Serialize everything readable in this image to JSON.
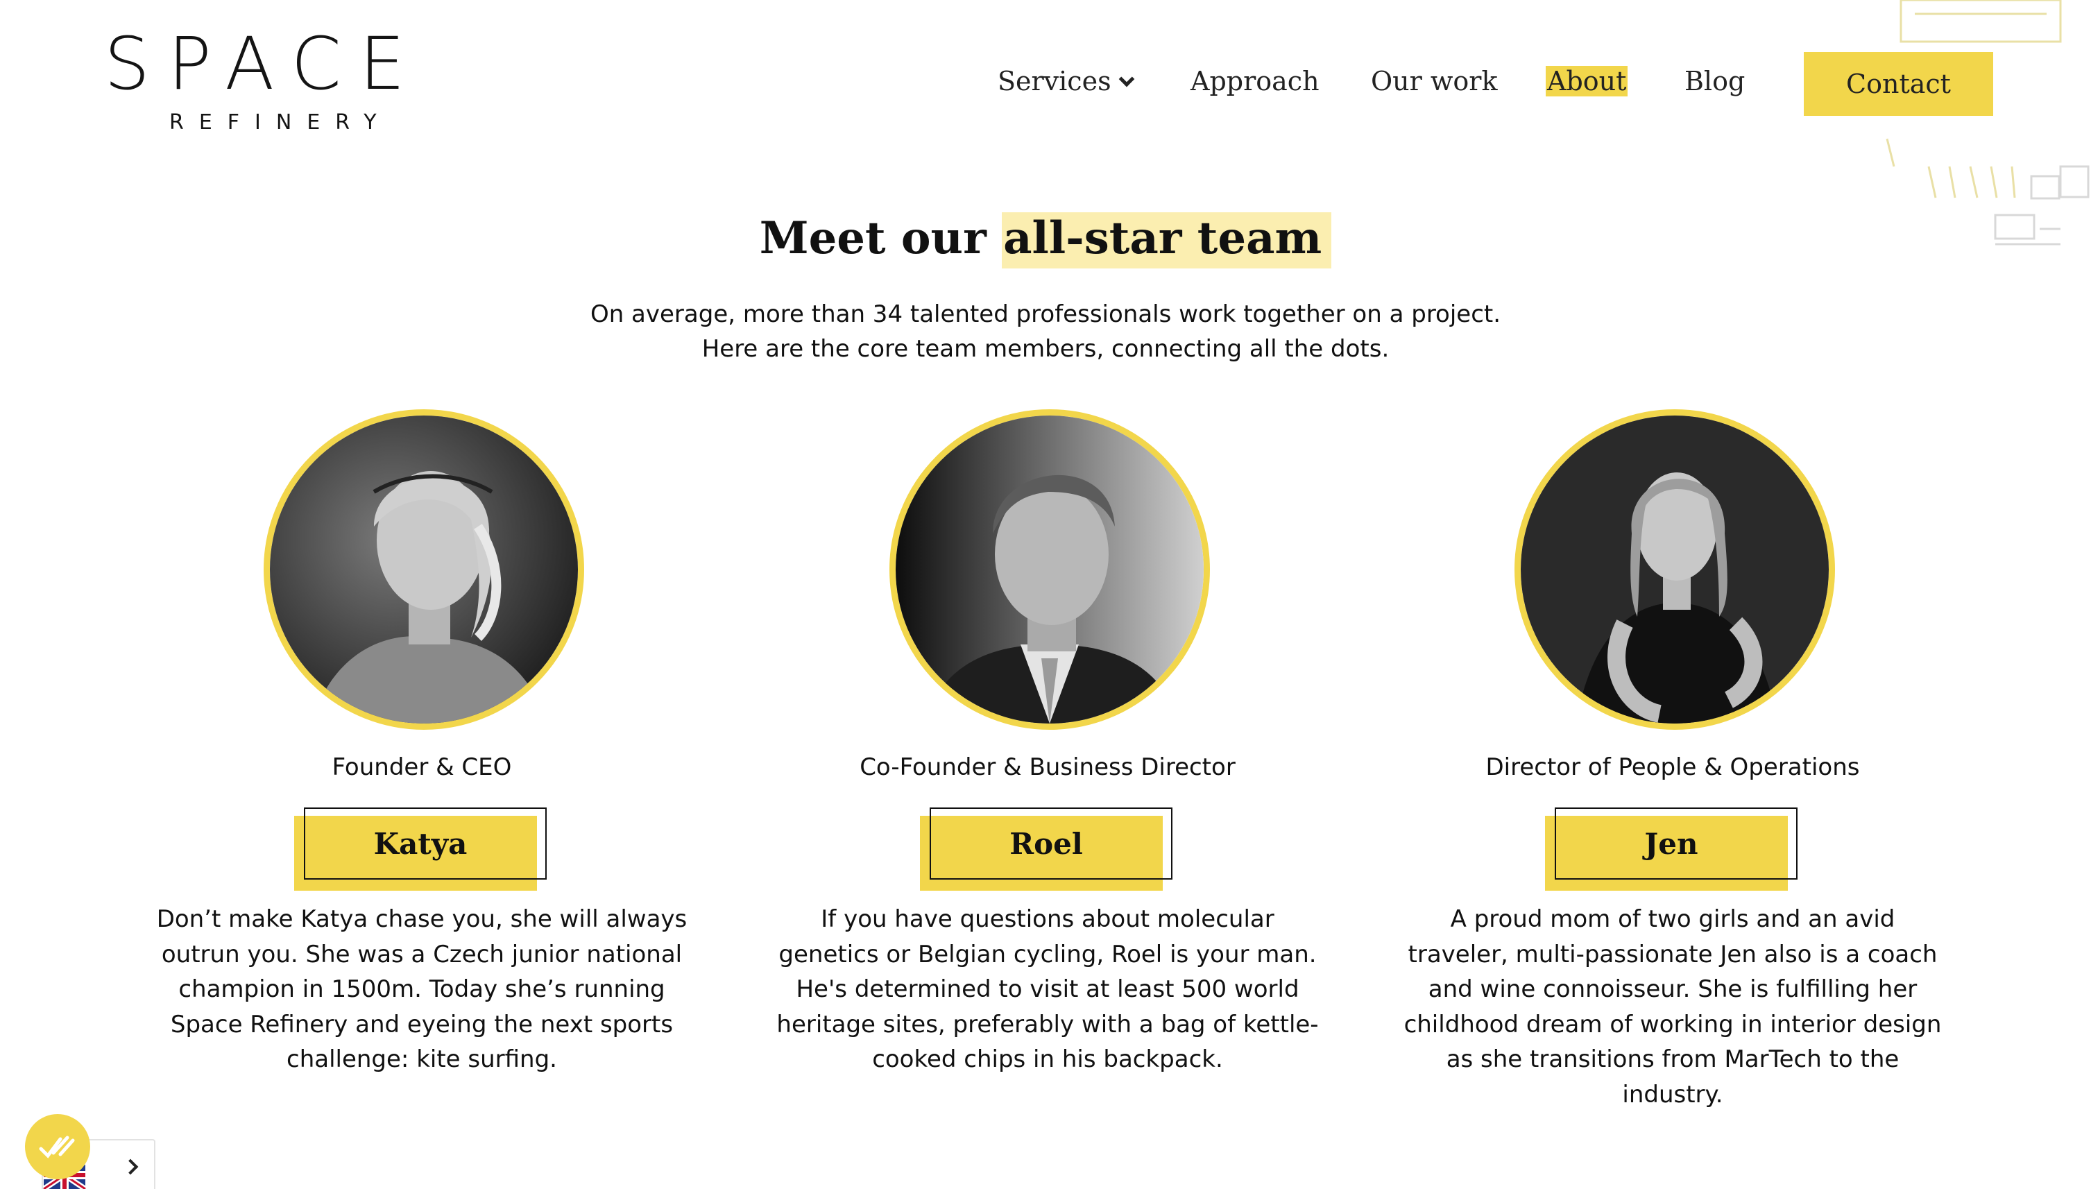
{
  "brand": {
    "logo_main": "SPACE",
    "logo_sub": "REFINERY",
    "accent_color": "#f2d64b"
  },
  "nav": {
    "items": [
      {
        "label": "Services",
        "has_dropdown": true,
        "icon": "chevron-down-icon"
      },
      {
        "label": "Approach"
      },
      {
        "label": "Our work"
      },
      {
        "label": "About",
        "active": true
      },
      {
        "label": "Blog"
      }
    ],
    "contact_label": "Contact"
  },
  "hero": {
    "heading_prefix": "Meet our ",
    "heading_highlight": "all-star team",
    "intro_line1": "On average, more than 34 talented professionals work together on a project.",
    "intro_line2": "Here are the core team members, connecting all the dots."
  },
  "team": [
    {
      "role": "Founder & CEO",
      "name": "Katya",
      "bio_lines": [
        "Don’t make Katya chase you, she will always",
        "outrun you. She was a Czech junior national",
        "champion in 1500m. Today she’s running",
        "Space Refinery and eyeing the next sports",
        "challenge: kite surfing."
      ]
    },
    {
      "role": "Co-Founder & Business Director",
      "name": "Roel",
      "bio_lines": [
        "If you have questions about molecular",
        "genetics or Belgian cycling, Roel is your man.",
        "He's determined to visit at least 500 world",
        "heritage sites, preferably with a bag of kettle-",
        "cooked chips in his backpack."
      ]
    },
    {
      "role": "Director of People & Operations",
      "name": "Jen",
      "bio_lines": [
        "A proud mom of two girls and an avid",
        "traveler, multi-passionate Jen also is a coach",
        "and wine connoisseur. She is fulfilling her",
        "childhood dream of working in interior design",
        "as she transitions from MarTech to the",
        "industry."
      ]
    }
  ],
  "widgets": {
    "cookie_icon": "cookie-consent-icon",
    "language_flag": "uk-flag-icon",
    "language_chevron": "chevron-right-icon"
  }
}
